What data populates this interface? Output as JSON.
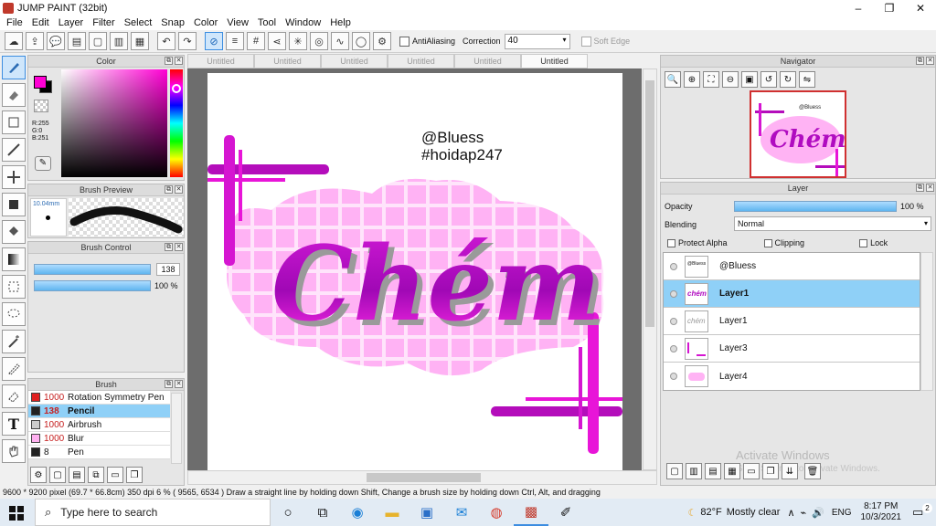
{
  "window": {
    "title": "JUMP PAINT (32bit)",
    "controls": [
      "–",
      "❐",
      "✕"
    ]
  },
  "menu": [
    "File",
    "Edit",
    "Layer",
    "Filter",
    "Select",
    "Snap",
    "Color",
    "View",
    "Tool",
    "Window",
    "Help"
  ],
  "toolbar": {
    "antialias_label": "AntiAliasing",
    "correction_label": "Correction",
    "correction_value": "40",
    "softedge_label": "Soft Edge"
  },
  "color_panel": {
    "title": "Color",
    "r": "R:255",
    "g": "G:0",
    "b": "B:251",
    "fg": "#ff00d4",
    "bg": "#000000"
  },
  "brush_preview": {
    "title": "Brush Preview",
    "size_label": "10.04mm"
  },
  "brush_control": {
    "title": "Brush Control",
    "size_value": "138",
    "size_fill": 0.98,
    "opacity_value": "100 %",
    "opacity_fill": 1.0
  },
  "brush_panel": {
    "title": "Brush",
    "items": [
      {
        "size": "1000",
        "name": "Rotation Symmetry Pen",
        "color": "#e02020",
        "selected": false
      },
      {
        "size": "138",
        "name": "Pencil",
        "color": "#222222",
        "selected": true
      },
      {
        "size": "1000",
        "name": "Airbrush",
        "color": "#cccccc",
        "selected": false
      },
      {
        "size": "1000",
        "name": "Blur",
        "color": "#ffb0f0",
        "selected": false
      },
      {
        "size": "8",
        "name": "Pen",
        "color": "#222222",
        "selected": false
      }
    ]
  },
  "doc_tabs": [
    "Untitled",
    "Untitled",
    "Untitled",
    "Untitled",
    "Untitled",
    "Untitled"
  ],
  "artwork": {
    "handle": "@Bluess",
    "hashtag": "#hoidap247",
    "word": "Chém"
  },
  "navigator": {
    "title": "Navigator"
  },
  "layer_panel": {
    "title": "Layer",
    "opacity_label": "Opacity",
    "opacity_value": "100 %",
    "blending_label": "Blending",
    "blending_value": "Normal",
    "protect_alpha": "Protect Alpha",
    "clipping": "Clipping",
    "lock": "Lock",
    "layers": [
      {
        "name": "@Bluess",
        "selected": false
      },
      {
        "name": "Layer1",
        "selected": true
      },
      {
        "name": "Layer1",
        "selected": false
      },
      {
        "name": "Layer3",
        "selected": false
      },
      {
        "name": "Layer4",
        "selected": false
      }
    ]
  },
  "watermark": {
    "line1": "Activate Windows",
    "line2": "Go to Settings to activate Windows."
  },
  "status": {
    "text": "9600 * 9200 pixel  (69.7 * 66.8cm)  350 dpi  6 %  ( 9565, 6534 )  Draw a straight line by holding down Shift, Change a brush size by holding down Ctrl, Alt, and dragging"
  },
  "taskbar": {
    "search_placeholder": "Type here to search",
    "temp": "82°F",
    "weather": "Mostly clear",
    "lang": "ENG",
    "time": "8:17 PM",
    "date": "10/3/2021",
    "notif": "2"
  }
}
